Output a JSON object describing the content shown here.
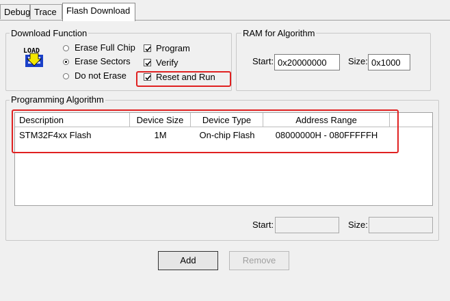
{
  "tabs": [
    {
      "label": "Debug",
      "active": false
    },
    {
      "label": "Trace",
      "active": false
    },
    {
      "label": "Flash Download",
      "active": true
    }
  ],
  "download_function": {
    "title": "Download Function",
    "icon": "load-flash-icon",
    "icon_text": "LOAD",
    "erase_options": [
      {
        "label": "Erase Full Chip",
        "selected": false
      },
      {
        "label": "Erase Sectors",
        "selected": true
      },
      {
        "label": "Do not Erase",
        "selected": false
      }
    ],
    "checks": [
      {
        "label": "Program",
        "checked": true
      },
      {
        "label": "Verify",
        "checked": true
      },
      {
        "label": "Reset and Run",
        "checked": true
      }
    ]
  },
  "ram": {
    "title": "RAM for Algorithm",
    "start_label": "Start:",
    "start_value": "0x20000000",
    "size_label": "Size:",
    "size_value": "0x1000"
  },
  "algorithm": {
    "title": "Programming Algorithm",
    "columns": [
      "Description",
      "Device Size",
      "Device Type",
      "Address Range"
    ],
    "rows": [
      {
        "description": "STM32F4xx Flash",
        "size": "1M",
        "type": "On-chip Flash",
        "range": "08000000H - 080FFFFFH"
      }
    ],
    "start_label": "Start:",
    "start_value": "",
    "size_label": "Size:",
    "size_value": ""
  },
  "buttons": {
    "add": "Add",
    "remove": "Remove"
  },
  "colors": {
    "highlight": "#e02020",
    "background": "#f0f0f0"
  }
}
